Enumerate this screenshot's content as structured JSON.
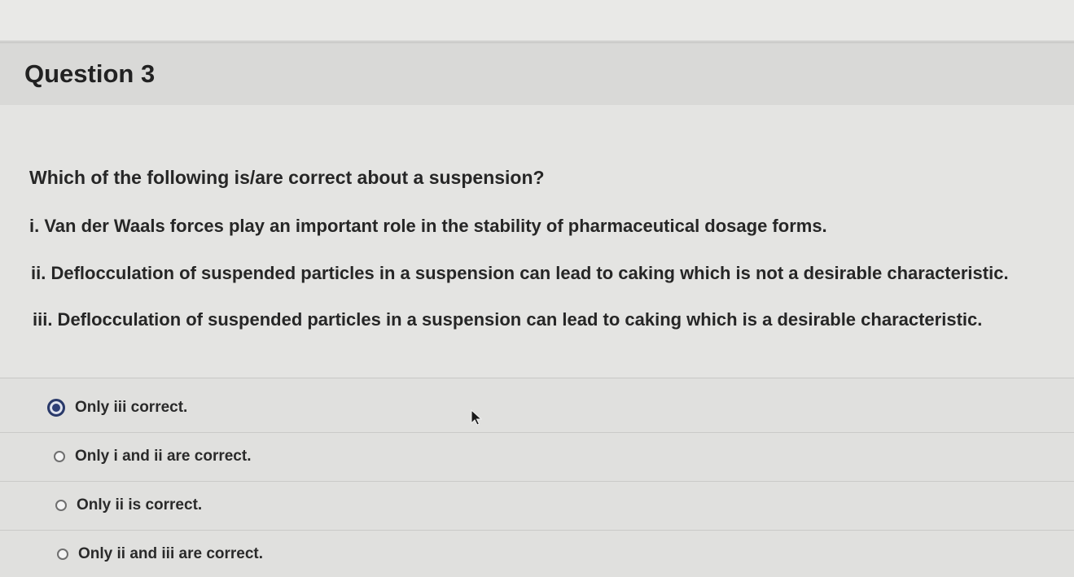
{
  "question": {
    "title": "Question 3",
    "prompt": "Which of the following is/are correct about a suspension?",
    "statements": [
      "i. Van der Waals forces play an important role in the stability of pharmaceutical dosage forms.",
      "ii. Deflocculation of suspended particles in a suspension can lead to caking which is not a desirable characteristic.",
      "iii. Deflocculation of suspended particles in a suspension can lead to caking which is a desirable characteristic."
    ]
  },
  "answers": {
    "options": [
      {
        "label": "Only iii correct.",
        "selected": true
      },
      {
        "label": "Only i and ii are correct.",
        "selected": false
      },
      {
        "label": "Only ii is correct.",
        "selected": false
      },
      {
        "label": "Only ii and iii are correct.",
        "selected": false
      }
    ]
  },
  "colors": {
    "selected_radio": "#2d3f77",
    "background": "#e3e3e1"
  },
  "icons": {
    "cursor": "mouse-pointer-icon"
  }
}
